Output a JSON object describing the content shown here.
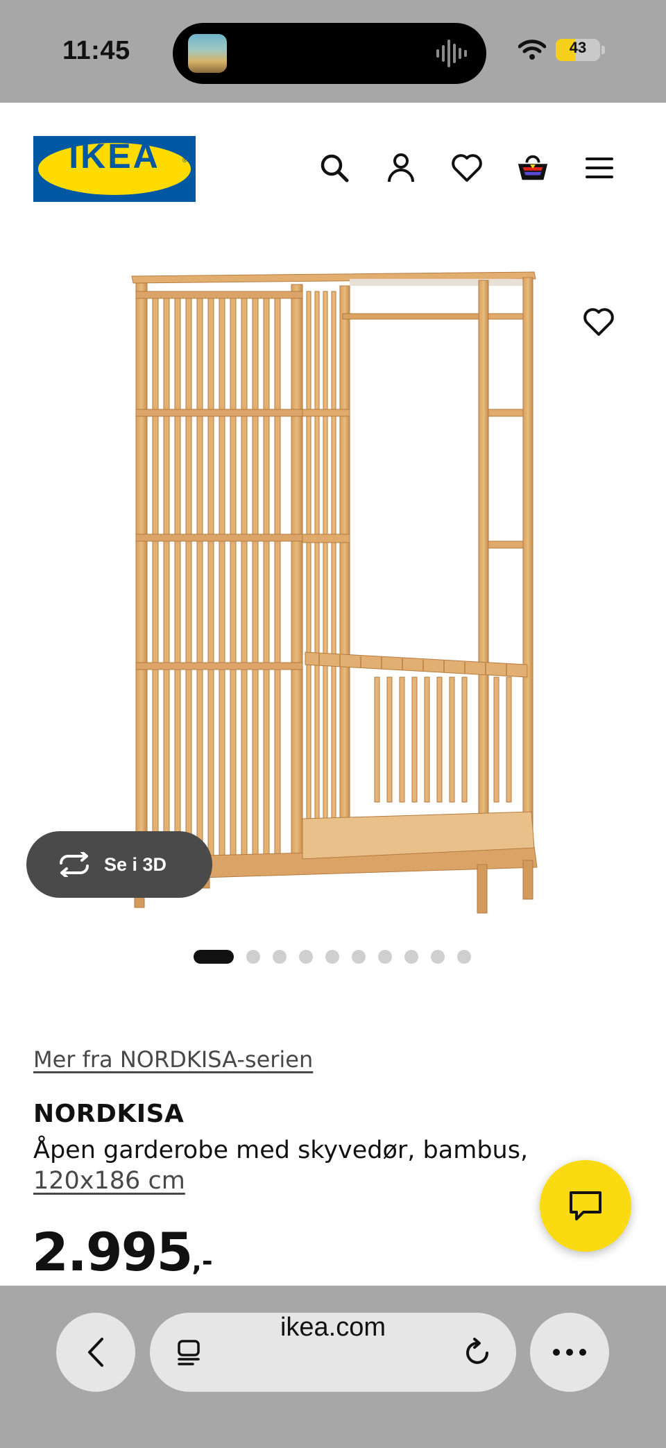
{
  "status_bar": {
    "time": "11:45",
    "battery_level": "43",
    "battery_fraction": 0.43,
    "battery_color": "#f5cf1a"
  },
  "header": {
    "logo_text": "IKEA",
    "logo_colors": {
      "blue": "#0058a3",
      "yellow": "#ffdb00"
    },
    "icons": [
      "search-icon",
      "account-icon",
      "favourites-icon",
      "basket-icon",
      "menu-icon"
    ]
  },
  "gallery": {
    "view_3d_label": "Se i 3D",
    "slide_count": 10,
    "active_slide": 1
  },
  "product": {
    "series_link": "Mer fra NORDKISA-serien",
    "name": "NORDKISA",
    "description": "Åpen garderobe med skyvedør, bambus,",
    "size": "120x186 cm",
    "price_main": "2.995",
    "price_suffix": ",-"
  },
  "chat": {
    "color": "#fadb11",
    "icon": "chat-icon"
  },
  "browser": {
    "url": "ikea.com",
    "icons": [
      "back-icon",
      "tabs-icon",
      "reload-icon",
      "more-icon"
    ]
  }
}
